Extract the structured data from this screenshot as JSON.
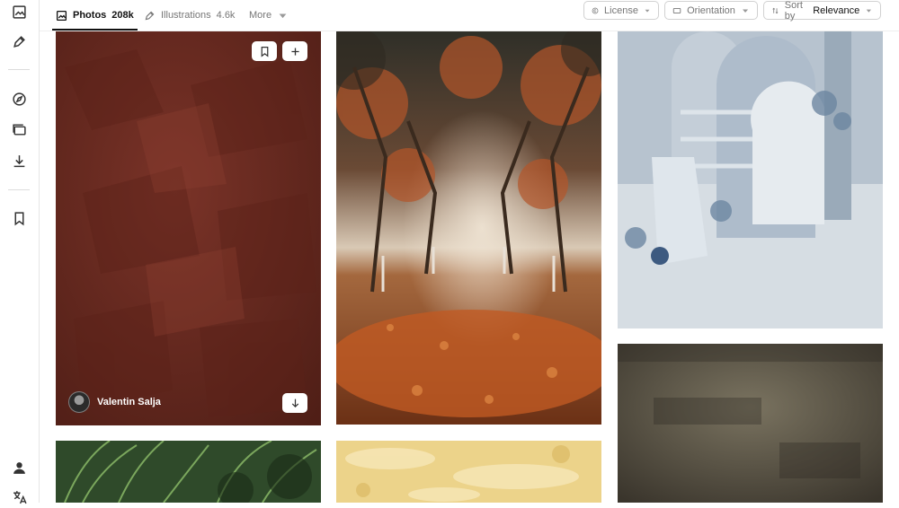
{
  "tabs": [
    {
      "label": "Photos",
      "count": "208k"
    },
    {
      "label": "Illustrations",
      "count": "4.6k"
    },
    {
      "label": "More"
    }
  ],
  "filters": {
    "license": "License",
    "orientation": "Orientation",
    "sort_prefix": "Sort by",
    "sort_value": "Relevance"
  },
  "sidebar": {
    "items": [
      {
        "icon": "image-icon"
      },
      {
        "icon": "pen-icon"
      },
      {
        "icon": "compass-icon"
      },
      {
        "icon": "collections-icon"
      },
      {
        "icon": "download-icon"
      },
      {
        "icon": "bookmark-icon"
      },
      {
        "icon": "user-icon"
      },
      {
        "icon": "translate-icon"
      }
    ]
  },
  "photos": [
    {
      "author": "Valentin Salja",
      "subject": "red-brown textured wall"
    },
    {
      "subject": "autumn forest path"
    },
    {
      "subject": "pale blue product scene"
    },
    {
      "subject": "grunge dark texture"
    },
    {
      "subject": "green plants"
    },
    {
      "subject": "yellow painted wall"
    }
  ],
  "colors": {
    "accent": "#111111",
    "muted": "#767676",
    "border": "#d1d1d1"
  }
}
